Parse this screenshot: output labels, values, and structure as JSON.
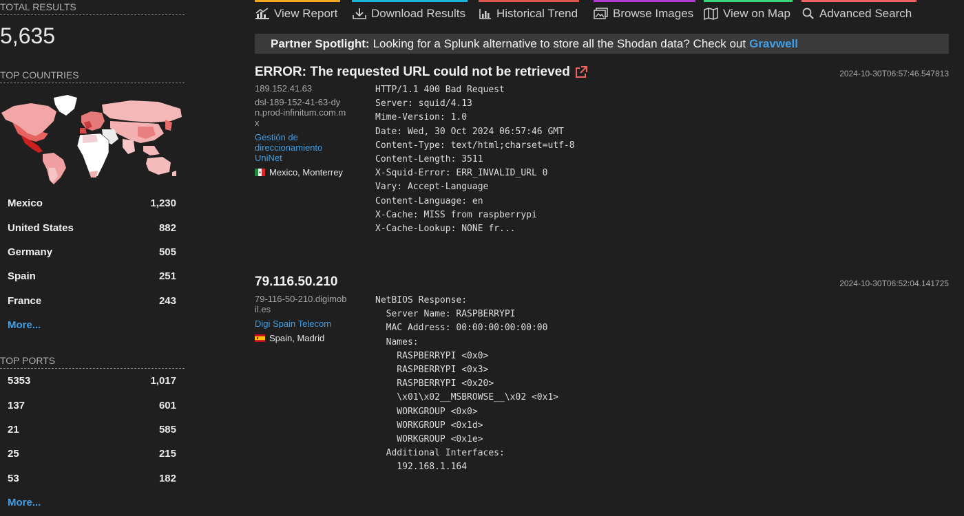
{
  "sidebar": {
    "total_title": "TOTAL RESULTS",
    "total_value": "5,635",
    "countries_title": "TOP COUNTRIES",
    "countries": [
      {
        "name": "Mexico",
        "count": "1,230"
      },
      {
        "name": "United States",
        "count": "882"
      },
      {
        "name": "Germany",
        "count": "505"
      },
      {
        "name": "Spain",
        "count": "251"
      },
      {
        "name": "France",
        "count": "243"
      }
    ],
    "countries_more": "More...",
    "ports_title": "TOP PORTS",
    "ports": [
      {
        "name": "5353",
        "count": "1,017"
      },
      {
        "name": "137",
        "count": "601"
      },
      {
        "name": "21",
        "count": "585"
      },
      {
        "name": "25",
        "count": "215"
      },
      {
        "name": "53",
        "count": "182"
      }
    ],
    "ports_more": "More..."
  },
  "nav": [
    {
      "label": "View Report",
      "icon": "report-icon",
      "color": "#f5a623"
    },
    {
      "label": "Download Results",
      "icon": "download-icon",
      "color": "#1ab2d8"
    },
    {
      "label": "Historical Trend",
      "icon": "trend-icon",
      "color": "#e0574f"
    },
    {
      "label": "Browse Images",
      "icon": "images-icon",
      "color": "#b43ad6"
    },
    {
      "label": "View on Map",
      "icon": "map-icon",
      "color": "#37d67a"
    },
    {
      "label": "Advanced Search",
      "icon": "search-icon",
      "color": "#f06464"
    }
  ],
  "partner": {
    "prefix": "Partner Spotlight:",
    "text": "Looking for a Splunk alternative to store all the Shodan data? Check out",
    "link": "Gravwell"
  },
  "results": [
    {
      "title": "ERROR: The requested URL could not be retrieved",
      "timestamp": "2024-10-30T06:57:46.547813",
      "ip": "189.152.41.63",
      "hostname": "dsl-189-152-41-63-dyn.prod-infinitum.com.mx",
      "org": "Gestión de direccionamiento UniNet",
      "location": "Mexico, Monterrey",
      "banner": "HTTP/1.1 400 Bad Request\nServer: squid/4.13\nMime-Version: 1.0\nDate: Wed, 30 Oct 2024 06:57:46 GMT\nContent-Type: text/html;charset=utf-8\nContent-Length: 3511\nX-Squid-Error: ERR_INVALID_URL 0\nVary: Accept-Language\nContent-Language: en\nX-Cache: MISS from raspberrypi\nX-Cache-Lookup: NONE fr..."
    },
    {
      "title": "79.116.50.210",
      "timestamp": "2024-10-30T06:52:04.141725",
      "hostname": "79-116-50-210.digimobil.es",
      "org": "Digi Spain Telecom",
      "location": "Spain, Madrid",
      "banner": "NetBIOS Response:\n  Server Name: RASPBERRYPI\n  MAC Address: 00:00:00:00:00:00\n  Names:\n    RASPBERRYPI <0x0>\n    RASPBERRYPI <0x3>\n    RASPBERRYPI <0x20>\n    \\x01\\x02__MSBROWSE__\\x02 <0x1>\n    WORKGROUP <0x0>\n    WORKGROUP <0x1d>\n    WORKGROUP <0x1e>\n  Additional Interfaces:\n    192.168.1.164"
    }
  ]
}
